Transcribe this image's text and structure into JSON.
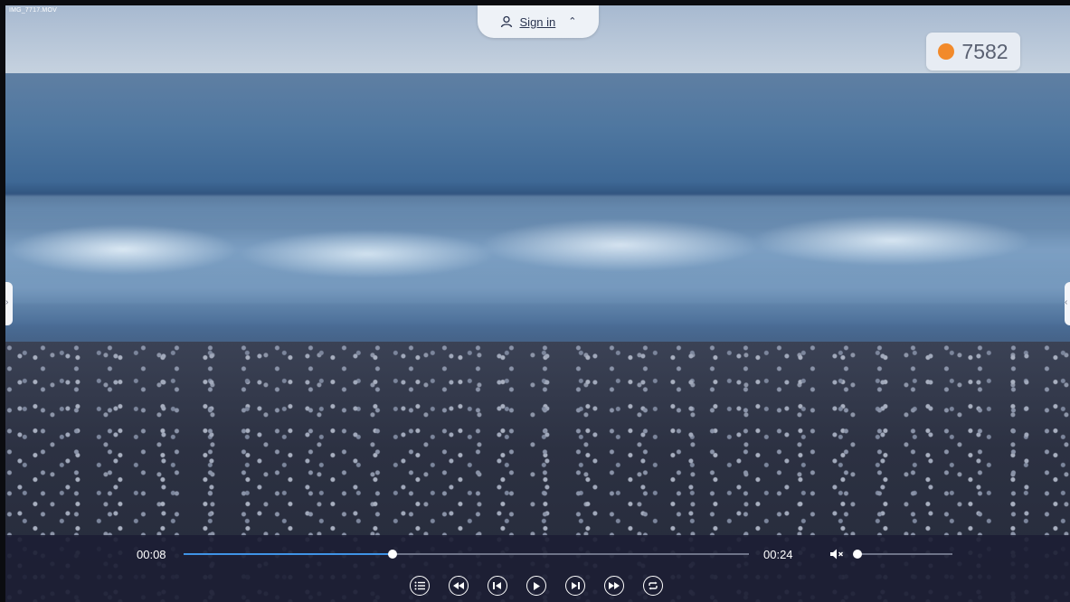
{
  "file": {
    "name": "IMG_7717.MOV"
  },
  "account": {
    "sign_in_label": "Sign in",
    "user_icon": "user-icon",
    "caret_icon": "chevron-up-icon"
  },
  "score": {
    "value": "7582",
    "dot_color": "#f28a2b"
  },
  "player": {
    "current_time": "00:08",
    "total_time": "00:24",
    "progress_fraction": 0.37,
    "muted": true,
    "volume_fraction": 0.0,
    "accent_color": "#3f93e6",
    "buttons": [
      {
        "name": "playlist-button",
        "icon": "list-icon"
      },
      {
        "name": "rewind-button",
        "icon": "rewind-icon"
      },
      {
        "name": "previous-button",
        "icon": "skip-previous-icon"
      },
      {
        "name": "play-button",
        "icon": "play-icon"
      },
      {
        "name": "next-button",
        "icon": "skip-next-icon"
      },
      {
        "name": "fast-forward-button",
        "icon": "fast-forward-icon"
      },
      {
        "name": "repeat-button",
        "icon": "repeat-icon"
      }
    ]
  },
  "side_panels": {
    "left_icon": "chevron-right-icon",
    "right_icon": "chevron-left-icon"
  }
}
